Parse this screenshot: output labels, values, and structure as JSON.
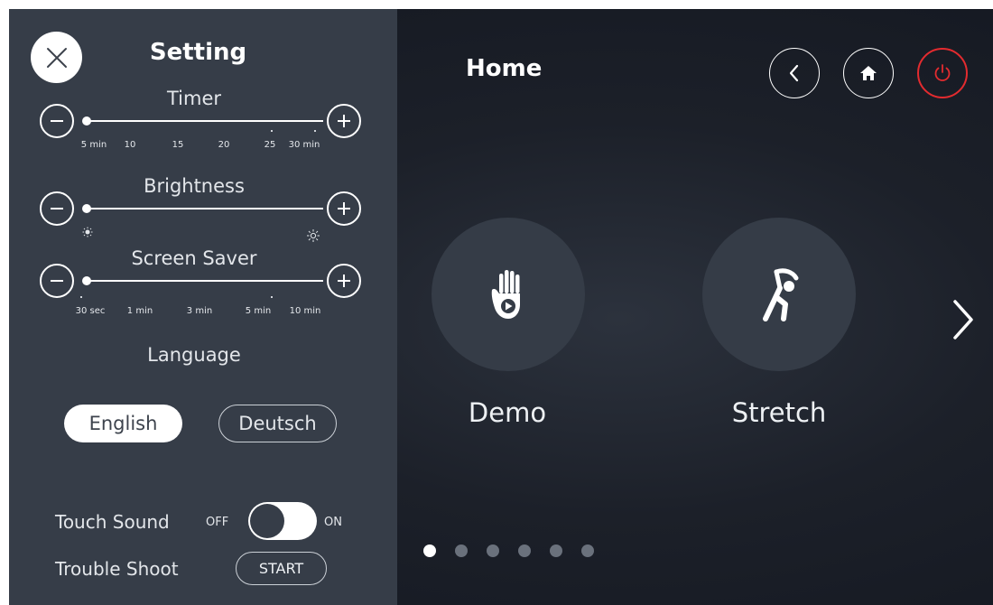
{
  "settings": {
    "title": "Setting",
    "timer": {
      "label": "Timer",
      "ticks": [
        "5 min",
        "10",
        "15",
        "20",
        "25",
        "30 min"
      ],
      "value": "5 min"
    },
    "brightness": {
      "label": "Brightness",
      "level": 0
    },
    "screen_saver": {
      "label": "Screen Saver",
      "ticks": [
        "30 sec",
        "1 min",
        "3 min",
        "5 min",
        "10 min"
      ],
      "value": "30 sec"
    },
    "language": {
      "label": "Language",
      "options": [
        "English",
        "Deutsch"
      ],
      "selected": "English"
    },
    "touch_sound": {
      "label": "Touch Sound",
      "off_label": "OFF",
      "on_label": "ON",
      "state": "off"
    },
    "trouble_shoot": {
      "label": "Trouble Shoot",
      "button": "START"
    }
  },
  "home": {
    "title": "Home",
    "tiles": [
      {
        "label": "Demo",
        "icon": "hand-play-icon"
      },
      {
        "label": "Stretch",
        "icon": "stretch-person-icon"
      }
    ],
    "page_count": 6,
    "current_page": 1
  },
  "colors": {
    "panel": "#363d48",
    "background": "#1c2029",
    "power": "#e32b2f",
    "accent": "#ffffff"
  }
}
